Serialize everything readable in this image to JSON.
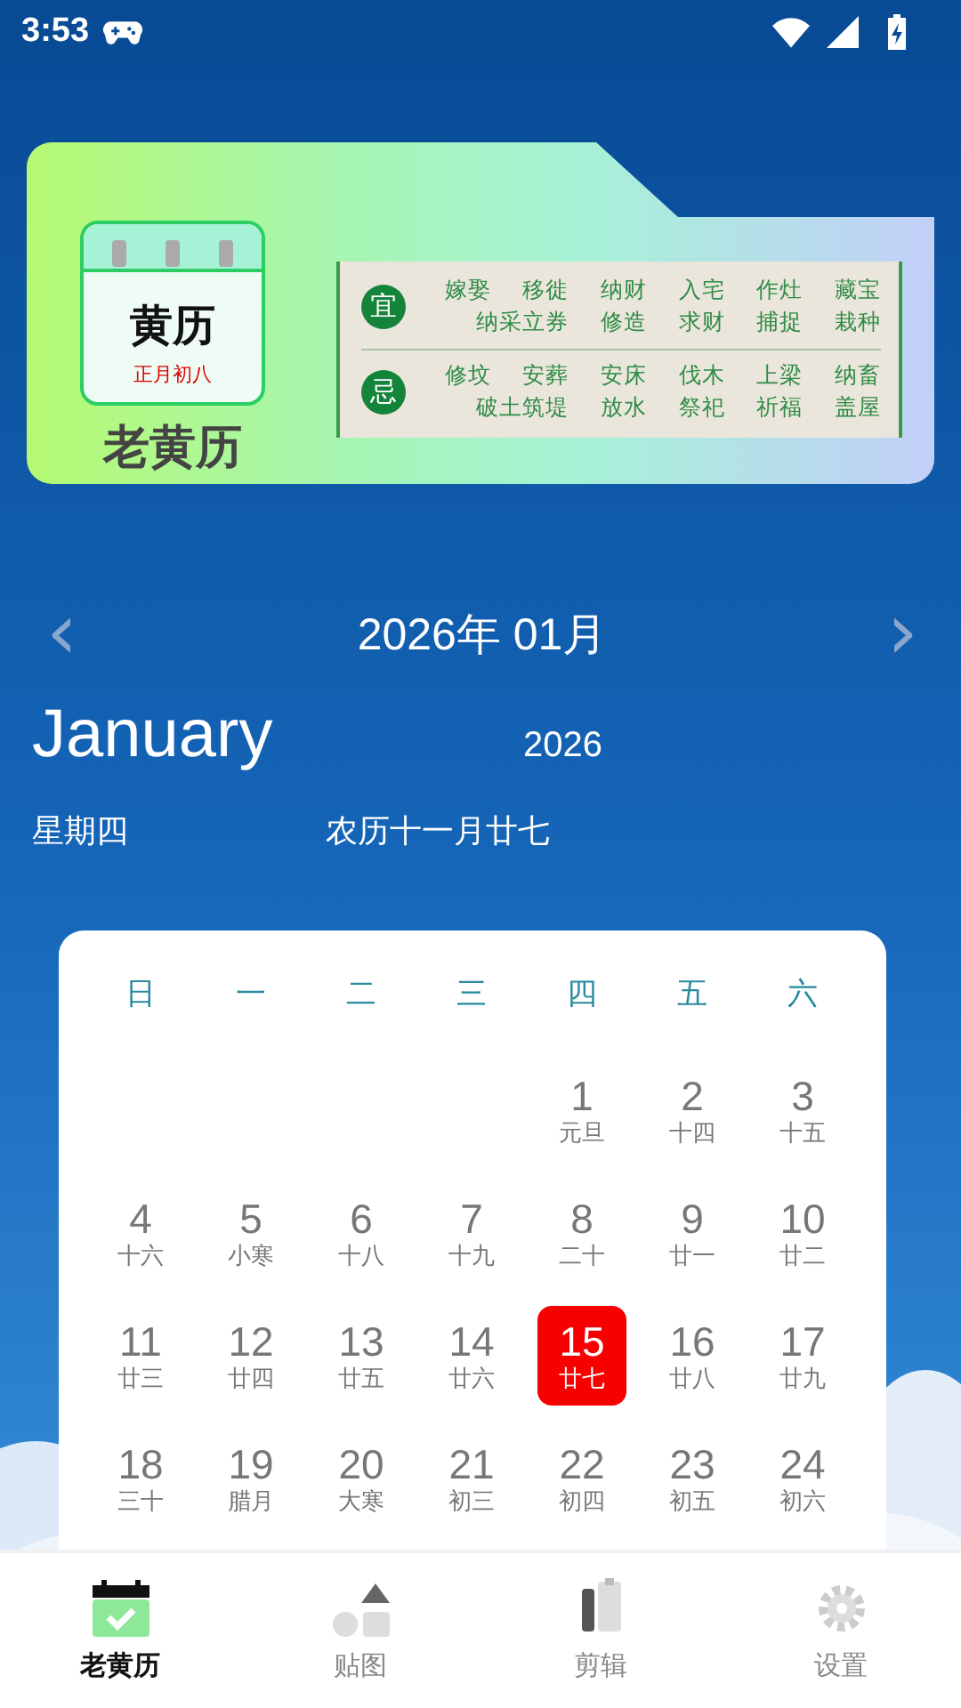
{
  "status_bar": {
    "time": "3:53"
  },
  "banner": {
    "icon_title": "黄历",
    "icon_subtitle": "正月初八",
    "app_name": "老黄历",
    "sections": [
      {
        "label": "宜",
        "lines": [
          [
            "嫁娶",
            "移徙",
            "纳财",
            "入宅",
            "作灶",
            "藏宝"
          ],
          [
            "纳采立券",
            "修造",
            "求财",
            "捕捉",
            "栽种"
          ]
        ]
      },
      {
        "label": "忌",
        "lines": [
          [
            "修坟",
            "安葬",
            "安床",
            "伐木",
            "上梁",
            "纳畜"
          ],
          [
            "破土筑堤",
            "放水",
            "祭祀",
            "祈福",
            "盖屋"
          ]
        ]
      }
    ]
  },
  "month_nav": {
    "prev": "‹",
    "title": "2026年 01月",
    "next": "›"
  },
  "today": {
    "month": "January",
    "year": "2026",
    "weekday": "星期四",
    "lunar": "农历十一月廿七"
  },
  "calendar": {
    "weekdays": [
      "日",
      "一",
      "二",
      "三",
      "四",
      "五",
      "六"
    ],
    "weeks": [
      [
        {
          "day": "1",
          "lunar": "元旦",
          "selected": false
        },
        {
          "day": "2",
          "lunar": "十四",
          "selected": false
        },
        {
          "day": "3",
          "lunar": "十五",
          "selected": false
        }
      ],
      [
        {
          "day": "4",
          "lunar": "十六",
          "selected": false
        },
        {
          "day": "5",
          "lunar": "小寒",
          "selected": false
        },
        {
          "day": "6",
          "lunar": "十八",
          "selected": false
        },
        {
          "day": "7",
          "lunar": "十九",
          "selected": false
        },
        {
          "day": "8",
          "lunar": "二十",
          "selected": false
        },
        {
          "day": "9",
          "lunar": "廿一",
          "selected": false
        },
        {
          "day": "10",
          "lunar": "廿二",
          "selected": false
        }
      ],
      [
        {
          "day": "11",
          "lunar": "廿三",
          "selected": false
        },
        {
          "day": "12",
          "lunar": "廿四",
          "selected": false
        },
        {
          "day": "13",
          "lunar": "廿五",
          "selected": false
        },
        {
          "day": "14",
          "lunar": "廿六",
          "selected": false
        },
        {
          "day": "15",
          "lunar": "廿七",
          "selected": true
        },
        {
          "day": "16",
          "lunar": "廿八",
          "selected": false
        },
        {
          "day": "17",
          "lunar": "廿九",
          "selected": false
        }
      ],
      [
        {
          "day": "18",
          "lunar": "三十",
          "selected": false
        },
        {
          "day": "19",
          "lunar": "腊月",
          "selected": false
        },
        {
          "day": "20",
          "lunar": "大寒",
          "selected": false
        },
        {
          "day": "21",
          "lunar": "初三",
          "selected": false
        },
        {
          "day": "22",
          "lunar": "初四",
          "selected": false
        },
        {
          "day": "23",
          "lunar": "初五",
          "selected": false
        },
        {
          "day": "24",
          "lunar": "初六",
          "selected": false
        }
      ]
    ]
  },
  "tab_bar": [
    {
      "kind": "calendar",
      "label": "老黄历",
      "selected": true
    },
    {
      "kind": "shapes",
      "label": "贴图",
      "selected": false
    },
    {
      "kind": "clip",
      "label": "剪辑",
      "selected": false
    },
    {
      "kind": "gear",
      "label": "设置",
      "selected": false
    }
  ]
}
